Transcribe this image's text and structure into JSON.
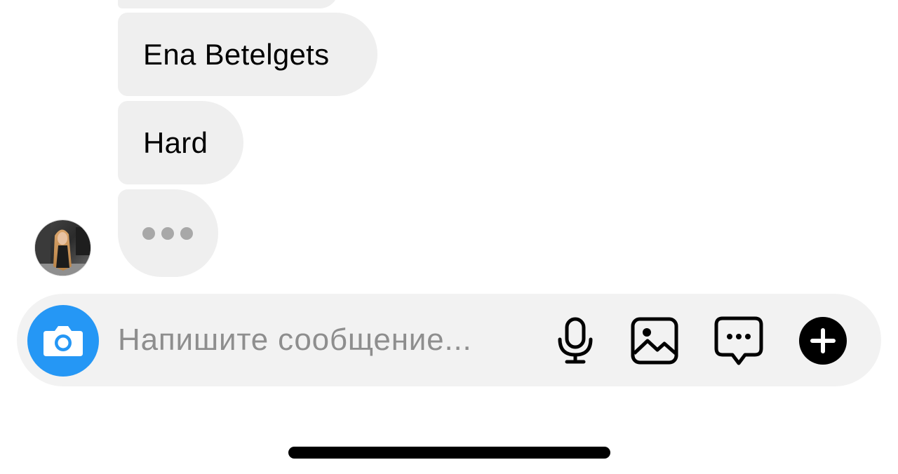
{
  "conversation": {
    "messages": [
      {
        "text": ""
      },
      {
        "text": "Ena Betelgets"
      },
      {
        "text": "Hard"
      }
    ],
    "typing_indicator": true,
    "sender_avatar": "avatar"
  },
  "composer": {
    "placeholder": "Напишите сообщение...",
    "value": "",
    "icons": {
      "camera": "camera-icon",
      "microphone": "microphone-icon",
      "gallery": "gallery-icon",
      "sticker": "sticker-chat-icon",
      "plus": "plus-icon"
    }
  },
  "colors": {
    "bubble": "#efefef",
    "composer_bg": "#f2f2f2",
    "camera_accent": "#2597f5",
    "placeholder": "#8e8e8e",
    "typing_dots": "#a8a8a8"
  }
}
